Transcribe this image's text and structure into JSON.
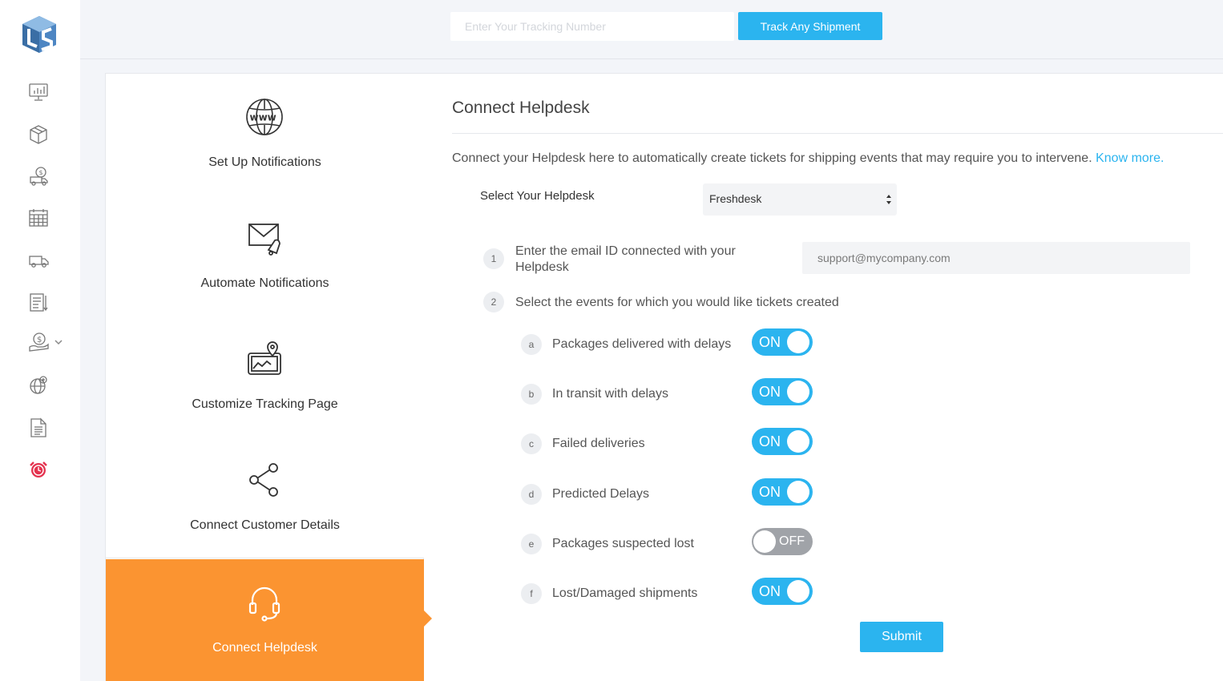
{
  "sidebar": {
    "logo_icon": "ls-logo-icon",
    "items": [
      {
        "name": "dashboard-icon"
      },
      {
        "name": "package-icon"
      },
      {
        "name": "cod-truck-icon"
      },
      {
        "name": "calendar-icon"
      },
      {
        "name": "delivery-truck-icon"
      },
      {
        "name": "report-icon"
      },
      {
        "name": "payments-icon"
      },
      {
        "name": "global-icon"
      },
      {
        "name": "document-icon"
      },
      {
        "name": "alarm-icon"
      }
    ]
  },
  "topbar": {
    "tracking_placeholder": "Enter Your Tracking Number",
    "track_button": "Track Any Shipment"
  },
  "steps": [
    {
      "label": "Set Up Notifications",
      "icon": "www-globe-icon",
      "active": false
    },
    {
      "label": "Automate Notifications",
      "icon": "mail-bell-icon",
      "active": false
    },
    {
      "label": "Customize Tracking Page",
      "icon": "tracking-map-icon",
      "active": false
    },
    {
      "label": "Connect Customer Details",
      "icon": "share-icon",
      "active": false
    },
    {
      "label": "Connect Helpdesk",
      "icon": "headset-icon",
      "active": true
    }
  ],
  "panel": {
    "title": "Connect Helpdesk",
    "intro": "Connect your Helpdesk here to automatically create tickets for shipping events that may require you to intervene.",
    "know_more": "Know more.",
    "helpdesk_label": "Select Your Helpdesk",
    "helpdesk_value": "Freshdesk",
    "q1_number": "1",
    "q1_text": "Enter the email ID connected with your Helpdesk",
    "email_placeholder": "support@mycompany.com",
    "q2_number": "2",
    "q2_text": "Select the events for which you would like tickets created",
    "events": [
      {
        "letter": "a",
        "label": "Packages delivered with delays",
        "state": "ON"
      },
      {
        "letter": "b",
        "label": "In transit with delays",
        "state": "ON"
      },
      {
        "letter": "c",
        "label": "Failed deliveries",
        "state": "ON"
      },
      {
        "letter": "d",
        "label": "Predicted Delays",
        "state": "ON"
      },
      {
        "letter": "e",
        "label": "Packages suspected lost",
        "state": "OFF"
      },
      {
        "letter": "f",
        "label": "Lost/Damaged shipments",
        "state": "ON"
      }
    ],
    "submit": "Submit"
  },
  "colors": {
    "accent": "#2bb4ef",
    "active_step": "#fb9431",
    "toggle_off": "#a0a3a8"
  }
}
